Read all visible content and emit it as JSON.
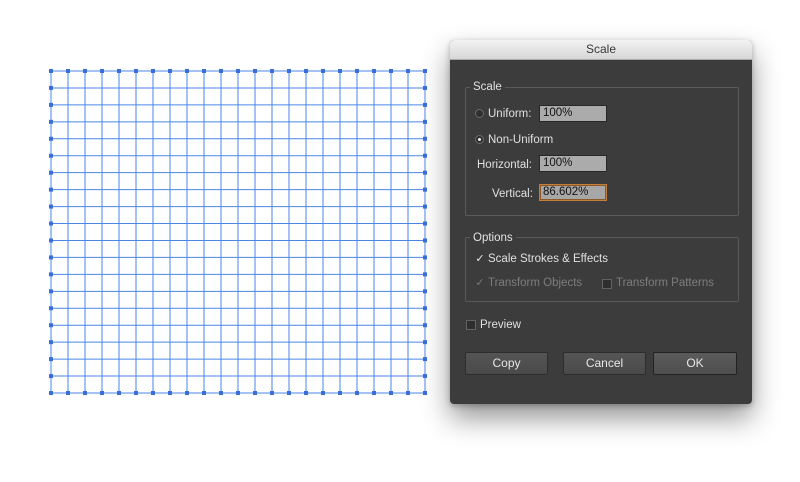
{
  "dialog": {
    "title": "Scale",
    "scale_group": {
      "legend": "Scale",
      "uniform": {
        "label": "Uniform:",
        "value": "100%",
        "selected": false
      },
      "non_uniform": {
        "label": "Non-Uniform",
        "selected": true
      },
      "horizontal": {
        "label": "Horizontal:",
        "value": "100%"
      },
      "vertical": {
        "label": "Vertical:",
        "value": "86.602%"
      }
    },
    "options_group": {
      "legend": "Options",
      "scale_strokes": {
        "label": "Scale Strokes & Effects",
        "checked": true
      },
      "transform_objects": {
        "label": "Transform Objects",
        "checked": true,
        "enabled": false
      },
      "transform_patterns": {
        "label": "Transform Patterns",
        "checked": false,
        "enabled": false
      }
    },
    "preview": {
      "label": "Preview",
      "checked": false
    },
    "buttons": {
      "copy": "Copy",
      "cancel": "Cancel",
      "ok": "OK"
    },
    "check_glyph": "✓"
  },
  "artwork": {
    "columns": 22,
    "rows": 19,
    "line_color": "#4a86e8",
    "handle_color": "#3a6fd8"
  }
}
